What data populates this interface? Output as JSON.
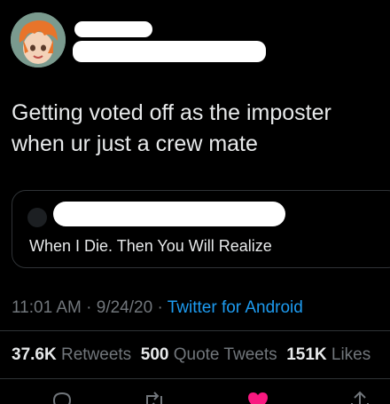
{
  "tweet": {
    "text": "Getting voted off as the imposter\nwhen ur just a crew mate",
    "quoted": {
      "text": "When I Die. Then You Will Realize"
    },
    "meta": {
      "time": "11:01 AM",
      "separator": " · ",
      "date": "9/24/20",
      "source": "Twitter for Android"
    },
    "stats": {
      "retweets_count": "37.6K",
      "retweets_label": "Retweets",
      "quotes_count": "500",
      "quotes_label": "Quote Tweets",
      "likes_count": "151K",
      "likes_label": "Likes"
    }
  },
  "icons": {
    "reply": "reply-icon",
    "retweet": "retweet-icon",
    "like": "heart-icon",
    "share": "share-icon"
  },
  "colors": {
    "background": "#000000",
    "text": "#e7e9ea",
    "muted": "#71767b",
    "link": "#1d9bf0",
    "like": "#f91880",
    "border": "#2f3336"
  }
}
